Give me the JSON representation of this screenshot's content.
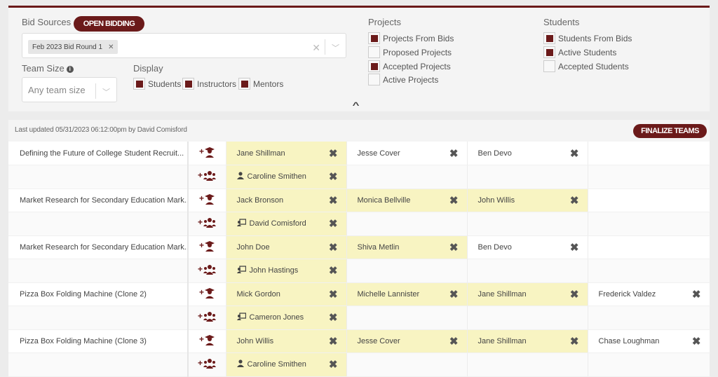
{
  "filters": {
    "bid_sources_label": "Bid Sources",
    "open_bidding_label": "OPEN BIDDING",
    "bid_source_tags": [
      "Feb 2023 Bid Round 1"
    ],
    "team_size_label": "Team Size",
    "team_size_placeholder": "Any team size",
    "display_label": "Display",
    "display_options": [
      {
        "label": "Students",
        "checked": true
      },
      {
        "label": "Instructors",
        "checked": true
      },
      {
        "label": "Mentors",
        "checked": true
      }
    ],
    "projects_label": "Projects",
    "projects_options": [
      {
        "label": "Projects From Bids",
        "checked": true
      },
      {
        "label": "Proposed Projects",
        "checked": false
      },
      {
        "label": "Accepted Projects",
        "checked": true
      },
      {
        "label": "Active Projects",
        "checked": false
      }
    ],
    "students_label": "Students",
    "students_options": [
      {
        "label": "Students From Bids",
        "checked": true
      },
      {
        "label": "Active Students",
        "checked": true
      },
      {
        "label": "Accepted Students",
        "checked": false
      }
    ]
  },
  "results": {
    "last_updated": "Last updated 05/31/2023 06:12:00pm by David Comisford",
    "finalize_label": "FINALIZE TEAMS",
    "highlight_color": "#f8f4c2",
    "accent_color": "#6b1a1a",
    "teams": [
      {
        "project": "Defining the Future of College Student Recruit...",
        "students": [
          {
            "name": "Jane Shillman",
            "highlight": true
          },
          {
            "name": "Jesse Cover",
            "highlight": false
          },
          {
            "name": "Ben Devo",
            "highlight": false
          },
          null
        ],
        "staff": {
          "name": "Caroline Smithen",
          "role": "mentor"
        }
      },
      {
        "project": "Market Research for Secondary Education Mark...",
        "students": [
          {
            "name": "Jack Bronson",
            "highlight": true
          },
          {
            "name": "Monica Bellville",
            "highlight": true
          },
          {
            "name": "John Willis",
            "highlight": true
          },
          null
        ],
        "staff": {
          "name": "David Comisford",
          "role": "instructor"
        }
      },
      {
        "project": "Market Research for Secondary Education Mark...",
        "students": [
          {
            "name": "John Doe",
            "highlight": true
          },
          {
            "name": "Shiva Metlin",
            "highlight": true
          },
          {
            "name": "Ben Devo",
            "highlight": false
          },
          null
        ],
        "staff": {
          "name": "John Hastings",
          "role": "instructor"
        }
      },
      {
        "project": "Pizza Box Folding Machine (Clone 2)",
        "students": [
          {
            "name": "Mick Gordon",
            "highlight": true
          },
          {
            "name": "Michelle Lannister",
            "highlight": true
          },
          {
            "name": "Jane Shillman",
            "highlight": true
          },
          {
            "name": "Frederick Valdez",
            "highlight": false
          }
        ],
        "staff": {
          "name": "Cameron Jones",
          "role": "instructor"
        }
      },
      {
        "project": "Pizza Box Folding Machine (Clone 3)",
        "students": [
          {
            "name": "John Willis",
            "highlight": true
          },
          {
            "name": "Jesse Cover",
            "highlight": true
          },
          {
            "name": "Jane Shillman",
            "highlight": true
          },
          {
            "name": "Chase Loughman",
            "highlight": false
          }
        ],
        "staff": {
          "name": "Caroline Smithen",
          "role": "mentor"
        }
      }
    ]
  }
}
